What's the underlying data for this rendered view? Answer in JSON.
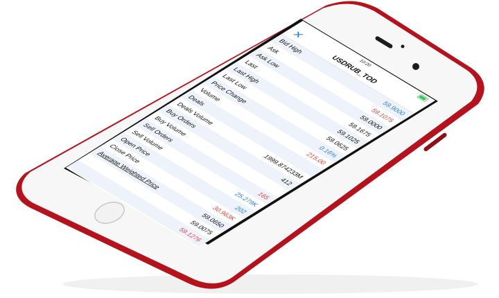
{
  "status_bar": {
    "time": "10:20"
  },
  "navbar": {
    "close_icon": "close-x-icon",
    "title": "USDRUB_TOD"
  },
  "rows": [
    {
      "label": "Bid High",
      "value": "59.9000",
      "color": "#2a7fe0"
    },
    {
      "label": "Ask",
      "value": "59.1075",
      "color": "#e8443a"
    },
    {
      "label": "Ask Low",
      "value": "59.0000",
      "color": "#111111"
    },
    {
      "label": "Last",
      "value": "59.1675",
      "color": "#111111"
    },
    {
      "label": "Last High",
      "value": "59.1025",
      "color": "#111111"
    },
    {
      "label": "Last Low",
      "value": "59.0625",
      "color": "#111111"
    },
    {
      "label": "Price Change",
      "value": "0.16%",
      "color": "#2a7fe0"
    },
    {
      "label": "Volume",
      "value": "215.00",
      "color": "#e8443a"
    },
    {
      "label": "Deals",
      "value": "",
      "color": "#111111"
    },
    {
      "label": "Deals Volume",
      "value": "1999.874233M",
      "color": "#111111"
    },
    {
      "label": "Buy Orders",
      "value": "412",
      "color": "#111111"
    },
    {
      "label": "Buy Volume",
      "value": "",
      "color": "#111111"
    },
    {
      "label": "Sell Orders",
      "value": "165",
      "color": "#e8443a"
    },
    {
      "label": "Sell Volume",
      "value": "25.279K",
      "color": "#2a7fe0"
    },
    {
      "label": "Open Price",
      "value": "202",
      "color": "#2a7fe0"
    },
    {
      "label": "Close Price",
      "value": "30.963K",
      "color": "#e8443a"
    },
    {
      "label": "Average Weighted Price",
      "value": "59.0650",
      "color": "#111111"
    },
    {
      "label": "",
      "value": "59.0075",
      "color": "#111111"
    },
    {
      "label": "",
      "value": "59.1276",
      "color": "#e8443a"
    }
  ]
}
